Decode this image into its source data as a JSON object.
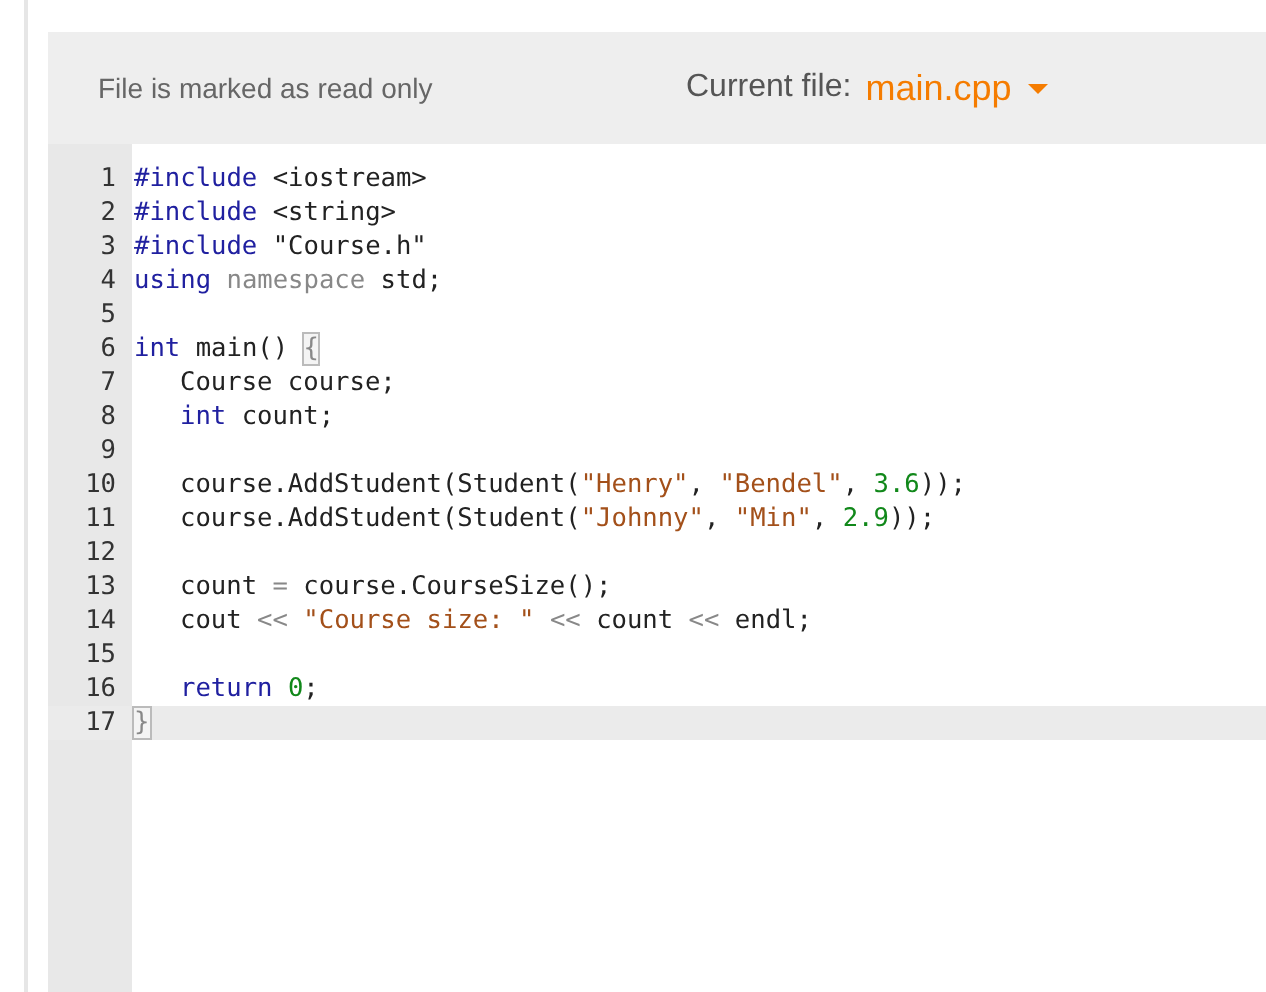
{
  "header": {
    "status": "File is marked as read only",
    "current_file_label": "Current file:",
    "current_file": "main.cpp"
  },
  "editor": {
    "lines": [
      {
        "number": "1",
        "active": false,
        "indented": false,
        "tokens": [
          {
            "keyword": "#include"
          },
          {
            "text": " <iostream>"
          }
        ]
      },
      {
        "number": "2",
        "active": false,
        "indented": false,
        "tokens": [
          {
            "keyword": "#include"
          },
          {
            "text": " <string>"
          }
        ]
      },
      {
        "number": "3",
        "active": false,
        "indented": false,
        "tokens": [
          {
            "keyword": "#include"
          },
          {
            "text": " \"Course.h\""
          }
        ]
      },
      {
        "number": "4",
        "active": false,
        "indented": false,
        "tokens": [
          {
            "keyword": "using"
          },
          {
            "operator": " namespace"
          },
          {
            "text": " std;"
          }
        ]
      },
      {
        "number": "5",
        "active": false
      },
      {
        "number": "6",
        "active": false,
        "indented": false,
        "tokens": [
          {
            "keyword": "int"
          },
          {
            "text": " main() "
          },
          {
            "bracket": "{"
          }
        ]
      },
      {
        "number": "7",
        "active": false,
        "indented": true,
        "tokens": [
          {
            "text": "Course course;"
          }
        ]
      },
      {
        "number": "8",
        "active": false,
        "indented": true,
        "tokens": [
          {
            "keyword": "int"
          },
          {
            "text": " count;"
          }
        ]
      },
      {
        "number": "9",
        "active": false
      },
      {
        "number": "10",
        "active": false,
        "indented": true,
        "tokens": [
          {
            "text": "course.AddStudent(Student("
          },
          {
            "string": "\"Henry\""
          },
          {
            "text": ", "
          },
          {
            "string": "\"Bendel\""
          },
          {
            "text": ", "
          },
          {
            "number": "3.6"
          },
          {
            "text": "));"
          }
        ]
      },
      {
        "number": "11",
        "active": false,
        "indented": true,
        "tokens": [
          {
            "text": "course.AddStudent(Student("
          },
          {
            "string": "\"Johnny\""
          },
          {
            "text": ", "
          },
          {
            "string": "\"Min\""
          },
          {
            "text": ", "
          },
          {
            "number": "2.9"
          },
          {
            "text": "));"
          }
        ]
      },
      {
        "number": "12",
        "active": false
      },
      {
        "number": "13",
        "active": false,
        "indented": true,
        "tokens": [
          {
            "text": "count "
          },
          {
            "operator": "="
          },
          {
            "text": " course.CourseSize();"
          }
        ]
      },
      {
        "number": "14",
        "active": false,
        "indented": true,
        "tokens": [
          {
            "text": "cout "
          },
          {
            "operator": "<<"
          },
          {
            "string": " \"Course size: \""
          },
          {
            "operator": " <<"
          },
          {
            "text": " count "
          },
          {
            "operator": "<<"
          },
          {
            "text": " endl;"
          }
        ]
      },
      {
        "number": "15",
        "active": false
      },
      {
        "number": "16",
        "active": false,
        "indented": true,
        "tokens": [
          {
            "keyword": "return"
          },
          {
            "number": " 0"
          },
          {
            "text": ";"
          }
        ]
      },
      {
        "number": "17",
        "active": true,
        "indented": false,
        "tokens": [
          {
            "bracket": "}"
          }
        ]
      }
    ]
  }
}
